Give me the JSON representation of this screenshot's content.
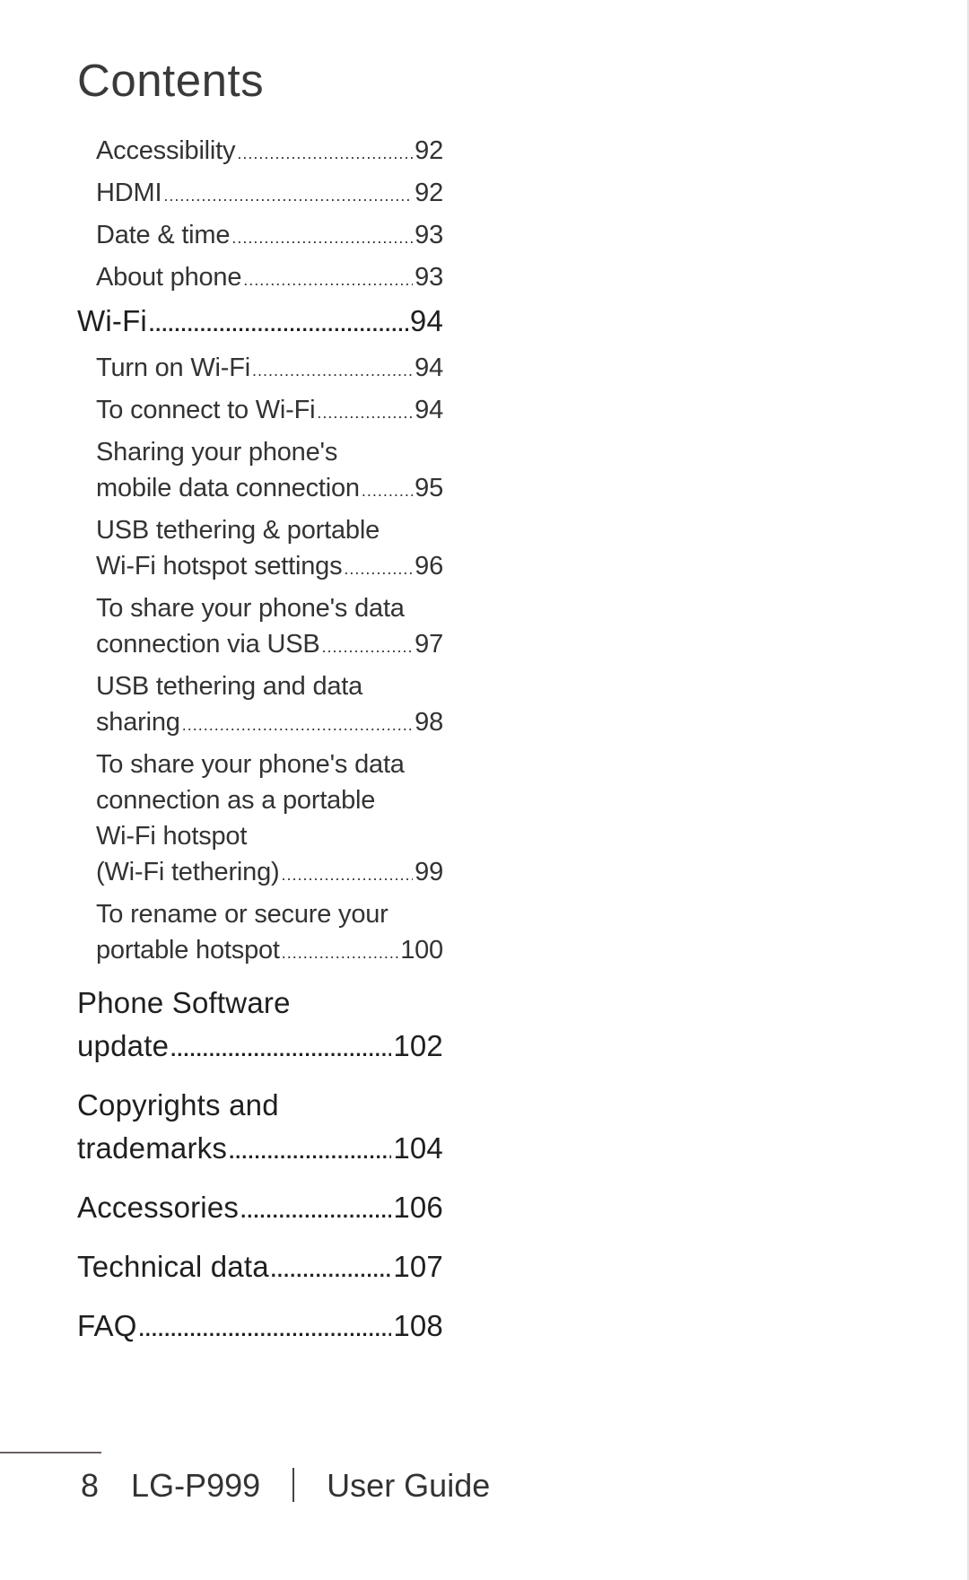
{
  "page": {
    "title": "Contents"
  },
  "toc": {
    "sub_top": [
      {
        "label": "Accessibility",
        "page": "92"
      },
      {
        "label": "HDMI",
        "page": "92"
      },
      {
        "label": "Date & time",
        "page": "93"
      },
      {
        "label": "About phone",
        "page": "93"
      }
    ],
    "wifi": {
      "label": "Wi-Fi",
      "page": "94"
    },
    "wifi_items": [
      {
        "lines": [],
        "label": "Turn on Wi-Fi",
        "page": "94"
      },
      {
        "lines": [],
        "label": "To connect to Wi-Fi",
        "page": "94"
      },
      {
        "lines": [
          "Sharing your phone's"
        ],
        "label": "mobile data connection",
        "page": "95"
      },
      {
        "lines": [
          "USB tethering & portable"
        ],
        "label": "Wi-Fi hotspot settings",
        "page": "96"
      },
      {
        "lines": [
          "To share your phone's data"
        ],
        "label": "connection via USB",
        "page": "97"
      },
      {
        "lines": [
          "USB tethering and data"
        ],
        "label": "sharing",
        "page": "98"
      },
      {
        "lines": [
          "To share your phone's data",
          "connection as a portable",
          "Wi-Fi hotspot"
        ],
        "label": "(Wi-Fi tethering)",
        "page": "99"
      },
      {
        "lines": [
          "To rename or secure your"
        ],
        "label": "portable hotspot",
        "page": "100"
      }
    ],
    "main_sections": [
      {
        "lines": [
          "Phone Software"
        ],
        "label": "update",
        "page": "102"
      },
      {
        "lines": [
          "Copyrights and"
        ],
        "label": "trademarks",
        "page": "104"
      },
      {
        "lines": [],
        "label": "Accessories",
        "page": "106"
      },
      {
        "lines": [],
        "label": "Technical data",
        "page": "107"
      },
      {
        "lines": [],
        "label": "FAQ",
        "page": "108"
      }
    ]
  },
  "footer": {
    "page_number": "8",
    "model": "LG-P999",
    "guide": "User Guide"
  }
}
